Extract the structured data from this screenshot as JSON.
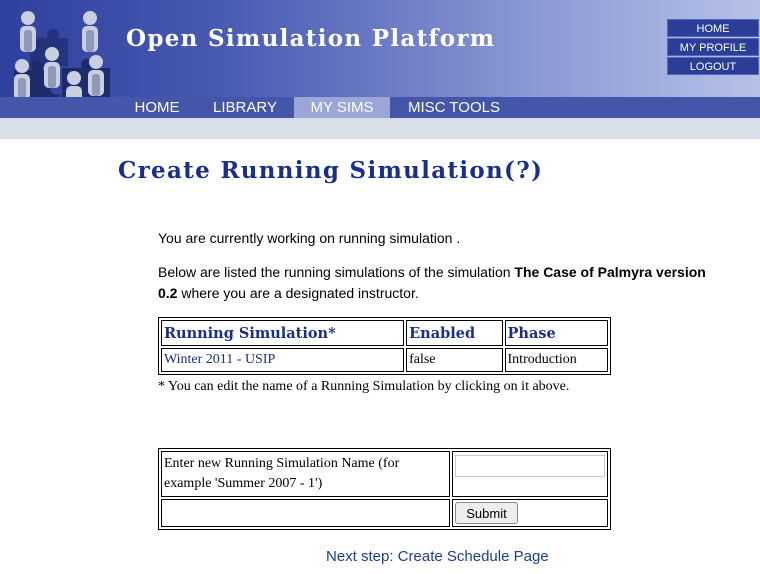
{
  "header": {
    "site_title": "Open Simulation Platform",
    "top_links": [
      "HOME",
      "MY PROFILE",
      "LOGOUT"
    ],
    "nav_tabs": [
      "HOME",
      "LIBRARY",
      "MY SIMS",
      "MISC TOOLS"
    ],
    "active_tab": "MY SIMS"
  },
  "main": {
    "title": "Create Running Simulation(?)",
    "working_on_text": "You are currently working on running simulation .",
    "listed_prefix": "Below are listed the running simulations of the simulation ",
    "simulation_name": "The Case of Palmyra version 0.2",
    "listed_suffix": " where you are a designated instructor.",
    "table": {
      "headers": [
        "Running Simulation*",
        "Enabled",
        "Phase"
      ],
      "rows": [
        {
          "name": "Winter 2011 - USIP",
          "enabled": "false",
          "phase": "Introduction"
        }
      ]
    },
    "edit_note": "* You can edit the name of a Running Simulation by clicking on it above.",
    "form": {
      "label": "Enter new Running Simulation Name (for example 'Summer 2007 - 1')",
      "input_value": "",
      "submit_label": "Submit"
    },
    "next_step_link": "Next step: Create Schedule Page"
  },
  "colors": {
    "brand_blue": "#2f3f9d",
    "heading_blue": "#1a2f8a",
    "link_blue": "#1a3f8f",
    "gray_band": "#d8dee8"
  }
}
